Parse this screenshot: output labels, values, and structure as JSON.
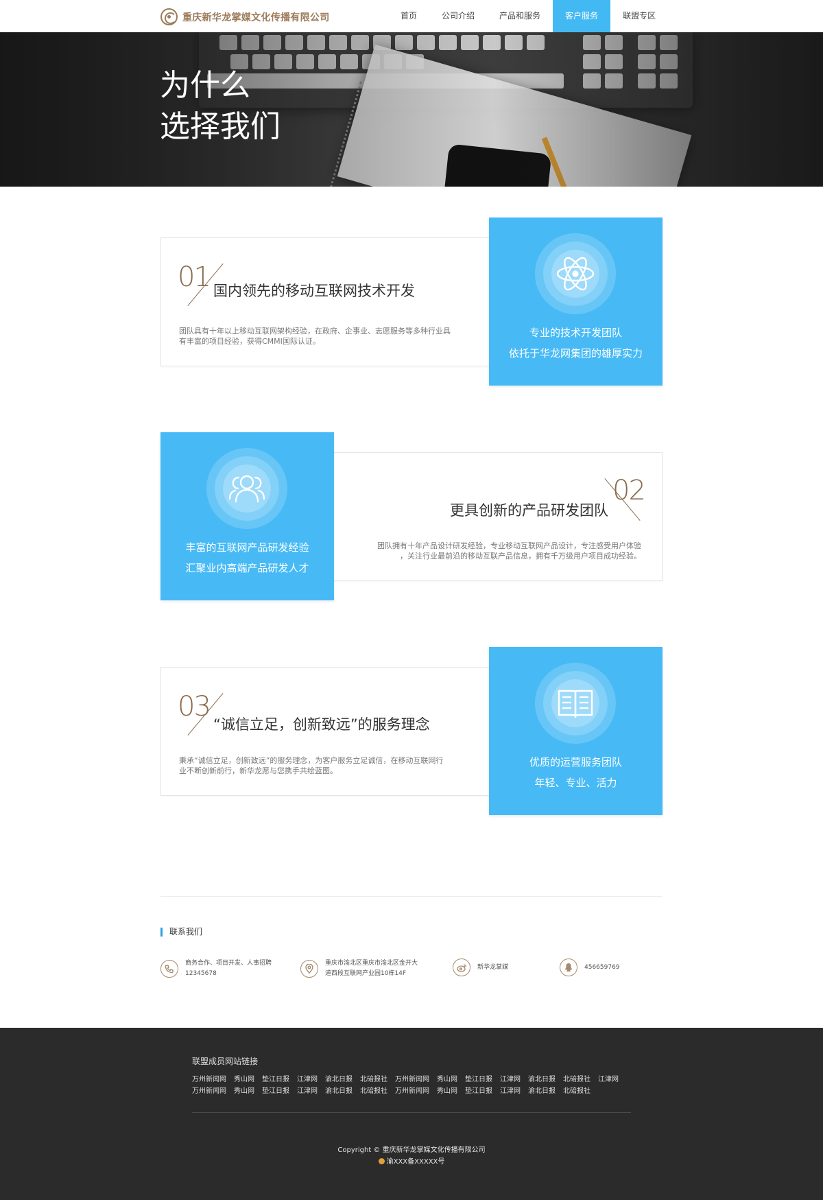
{
  "header": {
    "company_name": "重庆新华龙掌媒文化传播有限公司",
    "nav": [
      "首页",
      "公司介绍",
      "产品和服务",
      "客户服务",
      "联盟专区"
    ],
    "active_nav": "客户服务"
  },
  "banner": {
    "title_line1": "为什么",
    "title_line2": "选择我们"
  },
  "features": [
    {
      "number": "01",
      "title": "国内领先的移动互联网技术开发",
      "desc_line1": "团队具有十年以上移动互联网架构经验，在政府、企事业、志愿服务等多种行业具",
      "desc_line2": "有丰富的项目经验，获得CMMI国际认证。",
      "blue_line1": "专业的技术开发团队",
      "blue_line2": "依托于华龙网集团的雄厚实力",
      "icon": "atom-icon"
    },
    {
      "number": "02",
      "title": "更具创新的产品研发团队",
      "desc_line1": "团队拥有十年产品设计研发经验，专业移动互联网产品设计，专注感受用户体验",
      "desc_line2": "，关注行业最前沿的移动互联产品信息，拥有千万级用户项目成功经验。",
      "blue_line1": "丰富的互联网产品研发经验",
      "blue_line2": "汇聚业内高端产品研发人才",
      "icon": "users-icon"
    },
    {
      "number": "03",
      "title": "“诚信立足，创新致远”的服务理念",
      "desc_line1": "秉承“诚信立足，创新致远”的服务理念，为客户服务立足诚信，在移动互联网行",
      "desc_line2": "业不断创新前行，新华龙愿与您携手共绘蓝图。",
      "blue_line1": "优质的运营服务团队",
      "blue_line2": "年轻、专业、活力",
      "icon": "book-icon"
    }
  ],
  "contact": {
    "heading": "联系我们",
    "items": [
      {
        "line1": "商务合作、项目开发、人事招聘",
        "line2": "12345678",
        "icon": "phone-icon"
      },
      {
        "line1": "重庆市渝北区重庆市渝北区金开大",
        "line2": "道西段互联网产业园10栋14F",
        "icon": "location-icon"
      },
      {
        "line1": "新华龙掌媒",
        "line2": "",
        "icon": "weibo-icon"
      },
      {
        "line1": "456659769",
        "line2": "",
        "icon": "qq-icon"
      }
    ]
  },
  "footer": {
    "title": "联盟成员网站链接",
    "links_row1": [
      "万州新闻网",
      "秀山网",
      "垫江日报",
      "江津网",
      "渝北日报",
      "北碚报社",
      "万州新闻网",
      "秀山网",
      "垫江日报",
      "江津网",
      "渝北日报",
      "北碚报社",
      "江津网"
    ],
    "links_row2": [
      "万州新闻网",
      "秀山网",
      "垫江日报",
      "江津网",
      "渝北日报",
      "北碚报社",
      "万州新闻网",
      "秀山网",
      "垫江日报",
      "江津网",
      "渝北日报",
      "北碚报社"
    ],
    "copyright": "Copyright © 重庆新华龙掌媒文化传播有限公司",
    "icp": "渝XXX备XXXXX号"
  },
  "colors": {
    "accent_blue": "#47baf6",
    "brand_brown": "#8a6d4e",
    "footer_bg": "#2b2b2b"
  }
}
